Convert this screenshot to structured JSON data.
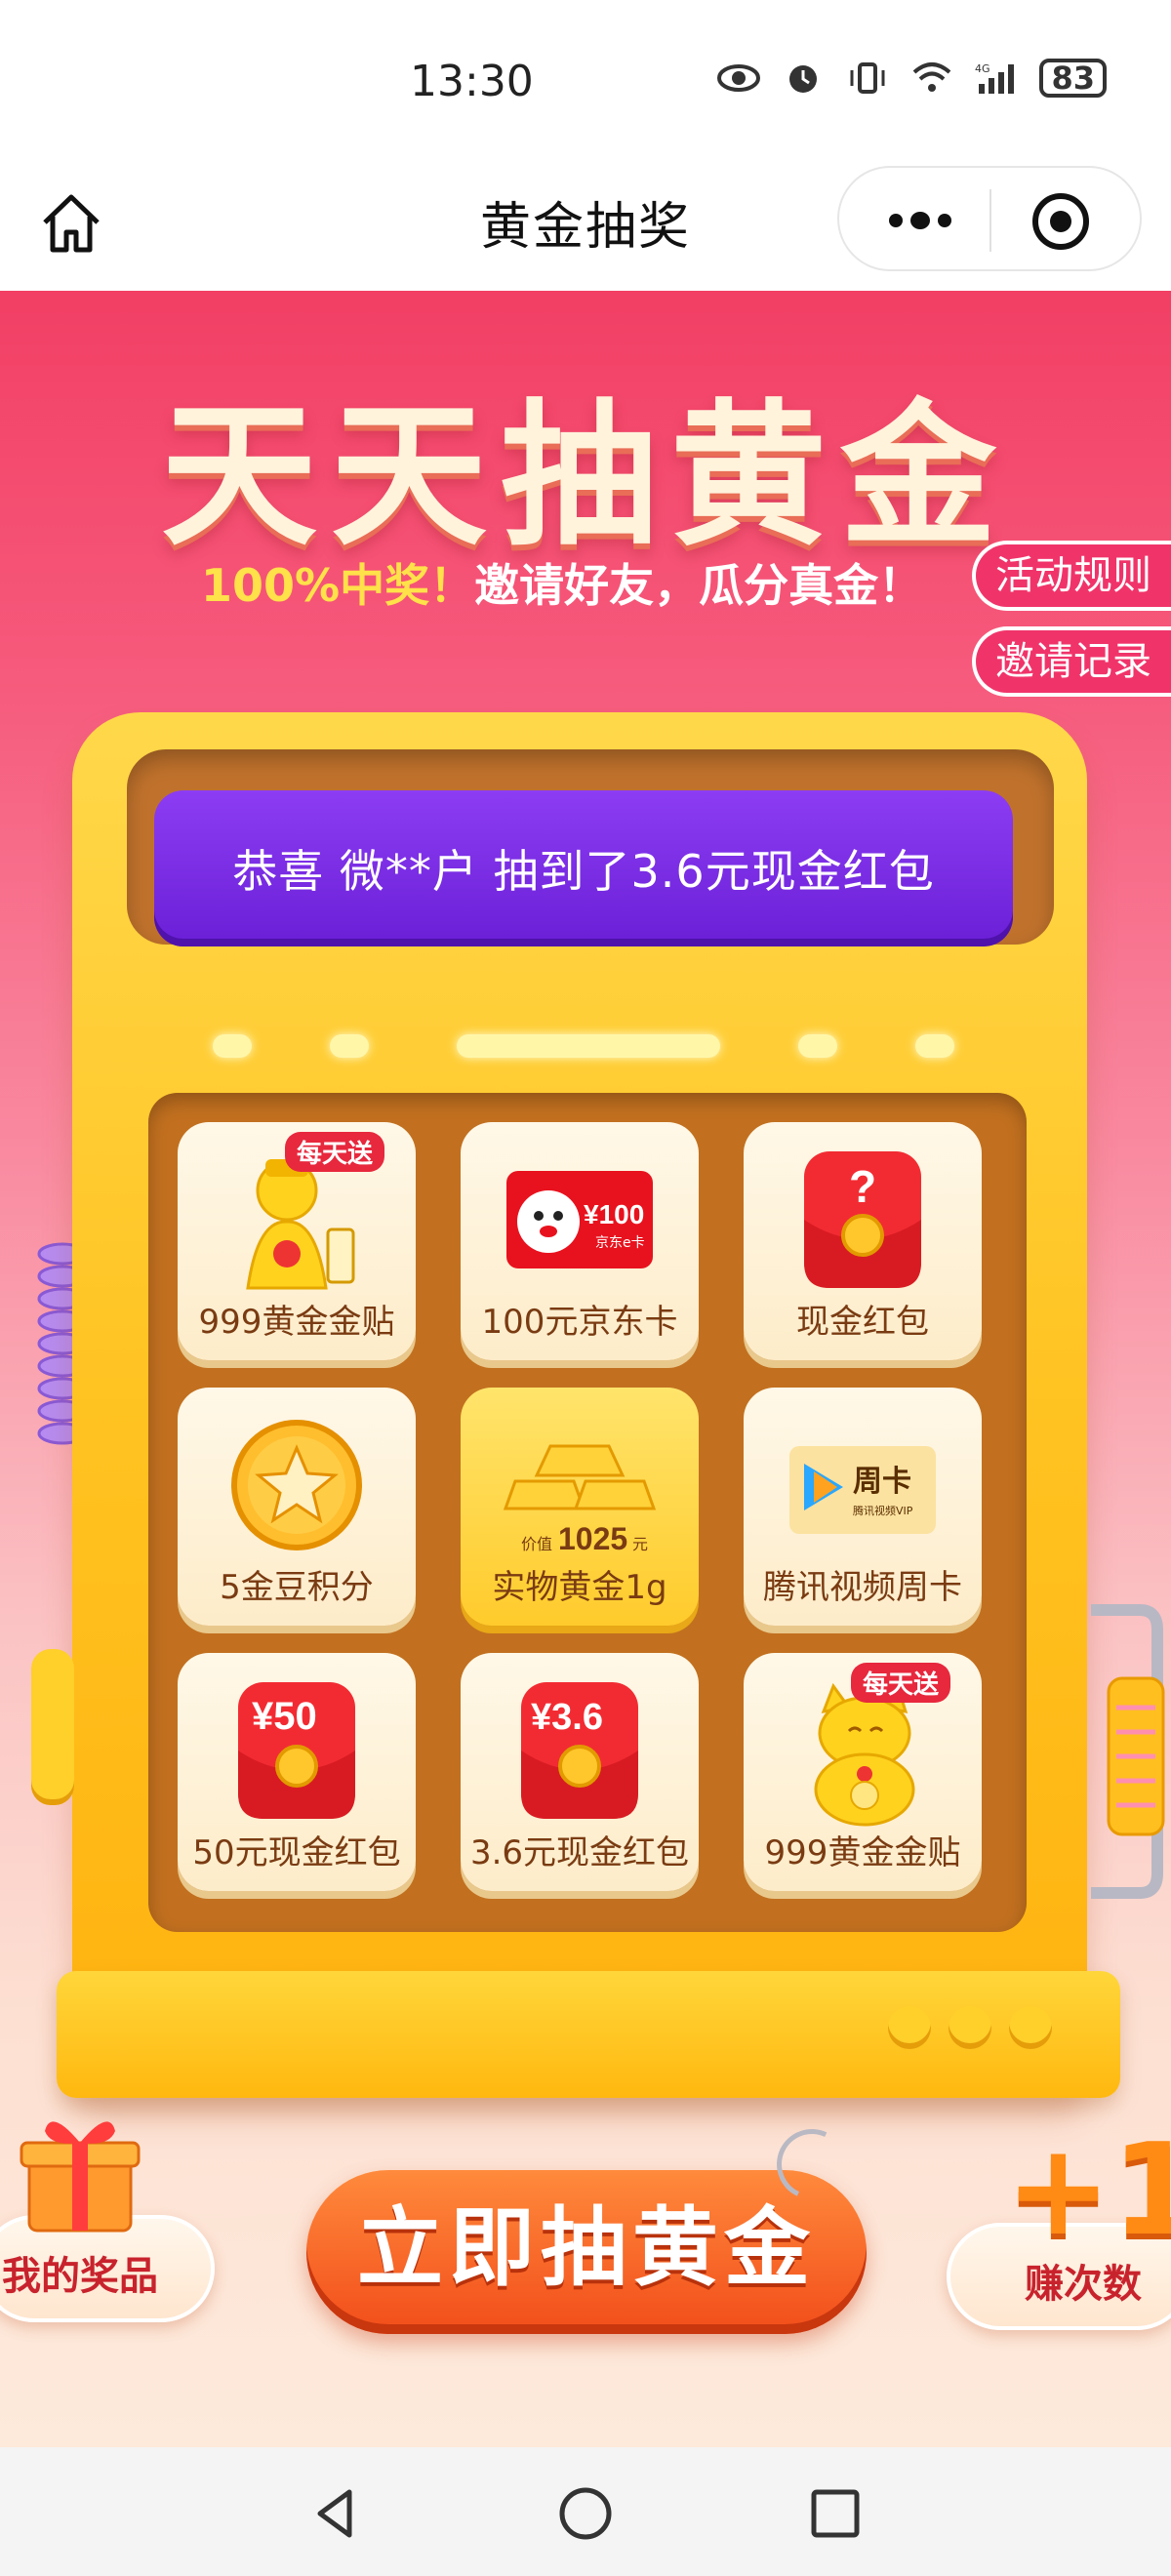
{
  "status_bar": {
    "time": "13:30",
    "battery": "83",
    "network": "4G"
  },
  "nav": {
    "title": "黄金抽奖"
  },
  "banner": {
    "headline": "天天抽黄金",
    "subtitle_highlight": "100%中奖！",
    "subtitle_text": "邀请好友，瓜分真金！",
    "rules_tab": "活动规则",
    "records_tab": "邀请记录"
  },
  "ticker": {
    "text": "恭喜 微**户 抽到了3.6元现金红包"
  },
  "grid": {
    "cells": [
      {
        "label": "999黄金金贴",
        "badge": "每天送",
        "icon": "god-of-wealth-icon"
      },
      {
        "label": "100元京东卡",
        "badge": "",
        "icon": "jd-card-icon",
        "card_value": "¥100",
        "card_sub": "京东e卡"
      },
      {
        "label": "现金红包",
        "badge": "",
        "icon": "mystery-red-packet-icon",
        "mark": "?"
      },
      {
        "label": "5金豆积分",
        "badge": "",
        "icon": "gold-coin-star-icon"
      },
      {
        "label": "实物黄金1g",
        "badge": "",
        "icon": "gold-bars-icon",
        "value_prefix": "价值",
        "value_number": "1025",
        "value_unit": "元"
      },
      {
        "label": "腾讯视频周卡",
        "badge": "",
        "icon": "tencent-video-icon",
        "card_title": "周卡",
        "card_sub": "腾讯视频VIP"
      },
      {
        "label": "50元现金红包",
        "badge": "",
        "icon": "red-packet-50-icon",
        "amount": "¥50"
      },
      {
        "label": "3.6元现金红包",
        "badge": "",
        "icon": "red-packet-3-6-icon",
        "amount": "¥3.6"
      },
      {
        "label": "999黄金金贴",
        "badge": "每天送",
        "icon": "lucky-cat-icon"
      }
    ]
  },
  "actions": {
    "my_prizes": "我的奖品",
    "draw": "立即抽黄金",
    "earn_plus": "+1",
    "earn": "赚次数"
  },
  "colors": {
    "brand_red": "#f23f64",
    "ticker_purple": "#7a2ee6",
    "gold": "#ffc321",
    "button_orange": "#f24d1a"
  }
}
